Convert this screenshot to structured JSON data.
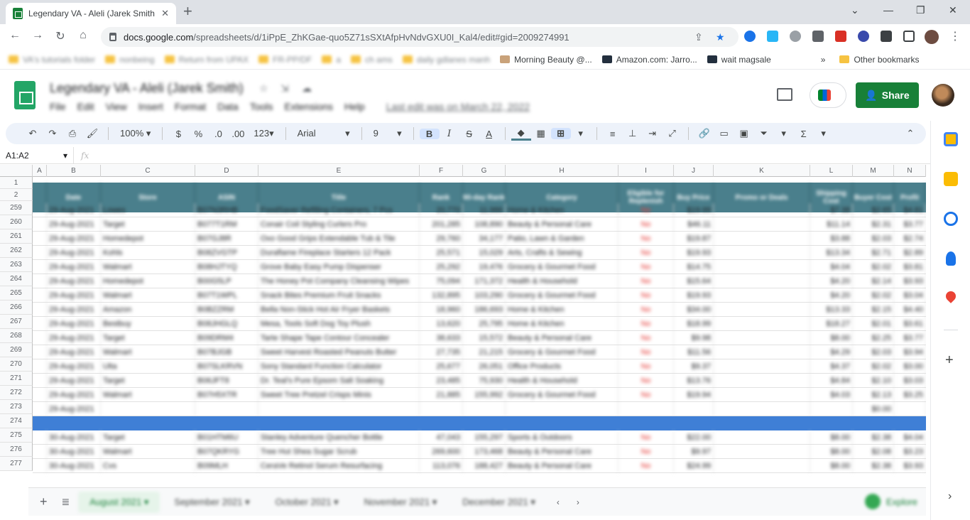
{
  "browser": {
    "tab_title": "Legendary VA - Aleli (Jarek Smith",
    "url_host": "docs.google.com",
    "url_path": "/spreadsheets/d/1iPpE_ZhKGae-quo5Z71sSXtAfpHvNdvGXU0I_Kal4/edit#gid=2009274991",
    "bookmarks": [
      "VA's tutorials folder",
      "nonbeing",
      "Return from UPAX",
      "FR-PP/DF",
      "a",
      "ch ams",
      "daily gdlanes manh",
      "Morning Beauty @...",
      "Amazon.com: Jarro...",
      "wait magsale",
      "»",
      "Other bookmarks"
    ]
  },
  "doc": {
    "title": "Legendary VA - Aleli (Jarek Smith)",
    "menus": [
      "File",
      "Edit",
      "View",
      "Insert",
      "Format",
      "Data",
      "Tools",
      "Extensions",
      "Help"
    ],
    "last_edit": "Last edit was on March 22, 2022",
    "share_label": "Share"
  },
  "toolbar": {
    "zoom": "100%",
    "currency": "$",
    "percent": "%",
    "dec_less": ".0",
    "dec_more": ".00",
    "format": "123",
    "font": "Arial",
    "font_size": "9",
    "bold": "B",
    "italic": "I",
    "strike": "S",
    "text_color": "A",
    "functions": "Σ"
  },
  "formula_bar": {
    "name_box": "A1:A2",
    "fx": "fx"
  },
  "columns": [
    "A",
    "B",
    "C",
    "D",
    "E",
    "F",
    "G",
    "H",
    "I",
    "J",
    "K",
    "L",
    "M",
    "N"
  ],
  "header_labels": [
    "",
    "Date",
    "Store",
    "ASIN",
    "Title",
    "Rank",
    "90-day Rank",
    "Category",
    "Eligible for Replenish",
    "Buy Price",
    "Promo or Deals",
    "Shipping Cost",
    "Buyer Cost",
    "Profit"
  ],
  "row_numbers": [
    "1",
    "2",
    "259",
    "260",
    "261",
    "262",
    "263",
    "264",
    "265",
    "266",
    "267",
    "268",
    "269",
    "270",
    "271",
    "272",
    "273",
    "274",
    "275",
    "276",
    "277"
  ],
  "rows": [
    [
      "",
      "29-Aug-2021",
      "Lowes",
      "B07N3RHB",
      "FoodSaver Refilling Containers, 7 Pcs",
      "20,770",
      "11,986",
      "Home & Kitchen",
      "No",
      "$19.99",
      "",
      "$7.38",
      "$2.65",
      "$4.81"
    ],
    [
      "",
      "29-Aug-2021",
      "Target",
      "B077T1RM",
      "Conair Coil Styling Curlers Pro",
      "201,285",
      "108,890",
      "Beauty & Personal Care",
      "No",
      "$46.11",
      "",
      "$11.14",
      "$2.31",
      "$3.77"
    ],
    [
      "",
      "29-Aug-2021",
      "Homedepot",
      "B07GJ8R",
      "Oxo Good Grips Extendable Tub & Tile",
      "29,760",
      "34,177",
      "Patio, Lawn & Garden",
      "No",
      "$19.87",
      "",
      "$3.88",
      "$2.03",
      "$2.74"
    ],
    [
      "",
      "29-Aug-2021",
      "Kohls",
      "B08ZVGTP",
      "Duraflame Fireplace Starters 12 Pack",
      "25,571",
      "15,029",
      "Arts, Crafts & Sewing",
      "No",
      "$19.93",
      "",
      "$13.34",
      "$2.71",
      "$2.89"
    ],
    [
      "",
      "29-Aug-2021",
      "Walmart",
      "B08HJTYQ",
      "Grove Baby Easy Pump Dispenser",
      "25,292",
      "19,476",
      "Grocery & Gourmet Food",
      "No",
      "$14.75",
      "",
      "$4.04",
      "$2.02",
      "$3.81"
    ],
    [
      "",
      "29-Aug-2021",
      "Homedepot",
      "B00G5LP",
      "The Honey Pot Company Cleansing Wipes",
      "75,094",
      "171,372",
      "Health & Household",
      "No",
      "$15.64",
      "",
      "$4.20",
      "$2.14",
      "$3.93"
    ],
    [
      "",
      "29-Aug-2021",
      "Walmart",
      "B07T1WPL",
      "Snack Bites Premium Fruit Snacks",
      "132,895",
      "103,290",
      "Grocery & Gourmet Food",
      "No",
      "$19.93",
      "",
      "$4.20",
      "$2.02",
      "$3.04"
    ],
    [
      "",
      "29-Aug-2021",
      "Amazon",
      "B0BZZRM",
      "Bella Non-Stick Hot Air Fryer Baskets",
      "18,960",
      "186,693",
      "Home & Kitchen",
      "No",
      "$34.00",
      "",
      "$13.33",
      "$2.15",
      "$4.40"
    ],
    [
      "",
      "29-Aug-2021",
      "Bestbuy",
      "B08JHGLQ",
      "Mesa, Tools Soft Dog Toy Plush",
      "13,620",
      "25,795",
      "Home & Kitchen",
      "No",
      "$18.99",
      "",
      "$18.27",
      "$2.01",
      "$3.61"
    ],
    [
      "",
      "29-Aug-2021",
      "Target",
      "B09DRM4",
      "Tarte Shape Tape Contour Concealer",
      "38,633",
      "15,572",
      "Beauty & Personal Care",
      "No",
      "$9.98",
      "",
      "$8.00",
      "$2.25",
      "$3.77"
    ],
    [
      "",
      "29-Aug-2021",
      "Walmart",
      "B07BJGB",
      "Sweet Harvest Roasted Peanuts Butter",
      "27,735",
      "21,215",
      "Grocery & Gourmet Food",
      "No",
      "$11.56",
      "",
      "$4.29",
      "$2.03",
      "$3.94"
    ],
    [
      "",
      "29-Aug-2021",
      "Ulta",
      "B07SLKRVN",
      "Sony Standard Function Calculator",
      "25,677",
      "26,051",
      "Office Products",
      "No",
      "$9.37",
      "",
      "$4.37",
      "$2.02",
      "$3.00"
    ],
    [
      "",
      "29-Aug-2021",
      "Target",
      "B06JFT8",
      "Dr. Teal's Pure Epsom Salt Soaking",
      "23,485",
      "75,930",
      "Health & Household",
      "No",
      "$13.76",
      "",
      "$4.84",
      "$2.10",
      "$3.03"
    ],
    [
      "",
      "29-Aug-2021",
      "Walmart",
      "B07H5XTR",
      "Sweet Tree Pretzel Crisps Minis",
      "21,885",
      "155,992",
      "Grocery & Gourmet Food",
      "No",
      "$19.94",
      "",
      "$4.03",
      "$2.13",
      "$3.25"
    ],
    [
      "",
      "29-Aug-2021",
      "",
      "",
      "",
      "",
      "",
      "",
      "",
      "",
      "",
      "",
      "$0.00",
      ""
    ],
    [
      "",
      "",
      "",
      "",
      "",
      "",
      "",
      "",
      "",
      "",
      "",
      "",
      "",
      ""
    ],
    [
      "",
      "30-Aug-2021",
      "Target",
      "B01HTM6U",
      "Stanley Adventure Quencher Bottle",
      "47,043",
      "155,297",
      "Sports & Outdoors",
      "No",
      "$22.00",
      "",
      "$8.00",
      "$2.38",
      "$4.04"
    ],
    [
      "",
      "30-Aug-2021",
      "Walmart",
      "B07QKRYG",
      "Tree Hut Shea Sugar Scrub",
      "269,600",
      "173,468",
      "Beauty & Personal Care",
      "No",
      "$9.97",
      "",
      "$8.00",
      "$2.08",
      "$3.23"
    ],
    [
      "",
      "30-Aug-2021",
      "Cvs",
      "B09MLH",
      "CeraVe Retinol Serum Resurfacing",
      "113,076",
      "188,427",
      "Beauty & Personal Care",
      "No",
      "$24.99",
      "",
      "$8.00",
      "$2.38",
      "$3.93"
    ]
  ],
  "sheet_tabs": [
    "August 2021",
    "September 2021",
    "October 2021",
    "November 2021",
    "December 2021"
  ],
  "explore_label": "Explore",
  "colors": {
    "header_teal": "#4a7f8c",
    "share_green": "#188038",
    "selection_blue": "#3f7fd6",
    "no_red": "#e53935"
  }
}
